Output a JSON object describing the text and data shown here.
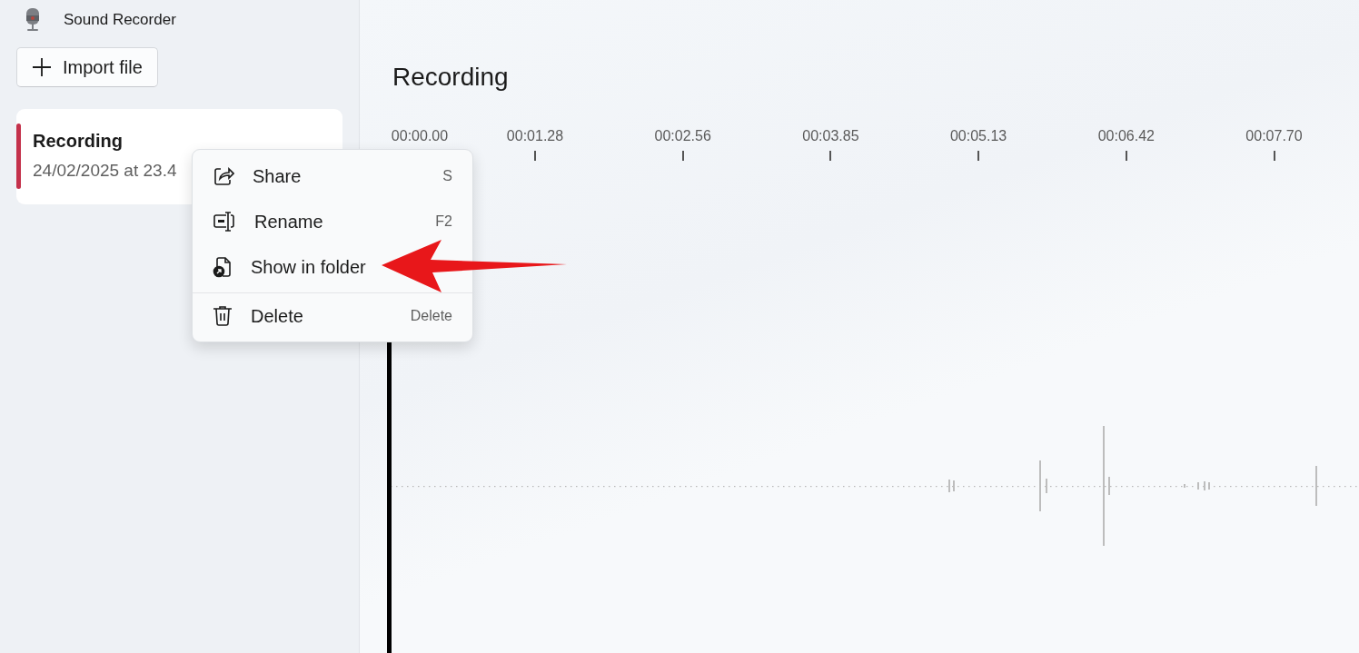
{
  "app": {
    "title": "Sound Recorder"
  },
  "import_button": {
    "label": "Import file"
  },
  "recordings": [
    {
      "title": "Recording",
      "date": "24/02/2025 at 23.4",
      "selected": true
    }
  ],
  "main": {
    "title": "Recording",
    "timeline": [
      "00:00.00",
      "00:01.28",
      "00:02.56",
      "00:03.85",
      "00:05.13",
      "00:06.42",
      "00:07.70"
    ]
  },
  "context_menu": {
    "items": [
      {
        "label": "Share",
        "shortcut": "S",
        "separator_before": false
      },
      {
        "label": "Rename",
        "shortcut": "F2",
        "separator_before": false
      },
      {
        "label": "Show in folder",
        "separator_before": false
      },
      {
        "label": "Delete",
        "shortcut": "Delete",
        "separator_before": true
      }
    ]
  }
}
